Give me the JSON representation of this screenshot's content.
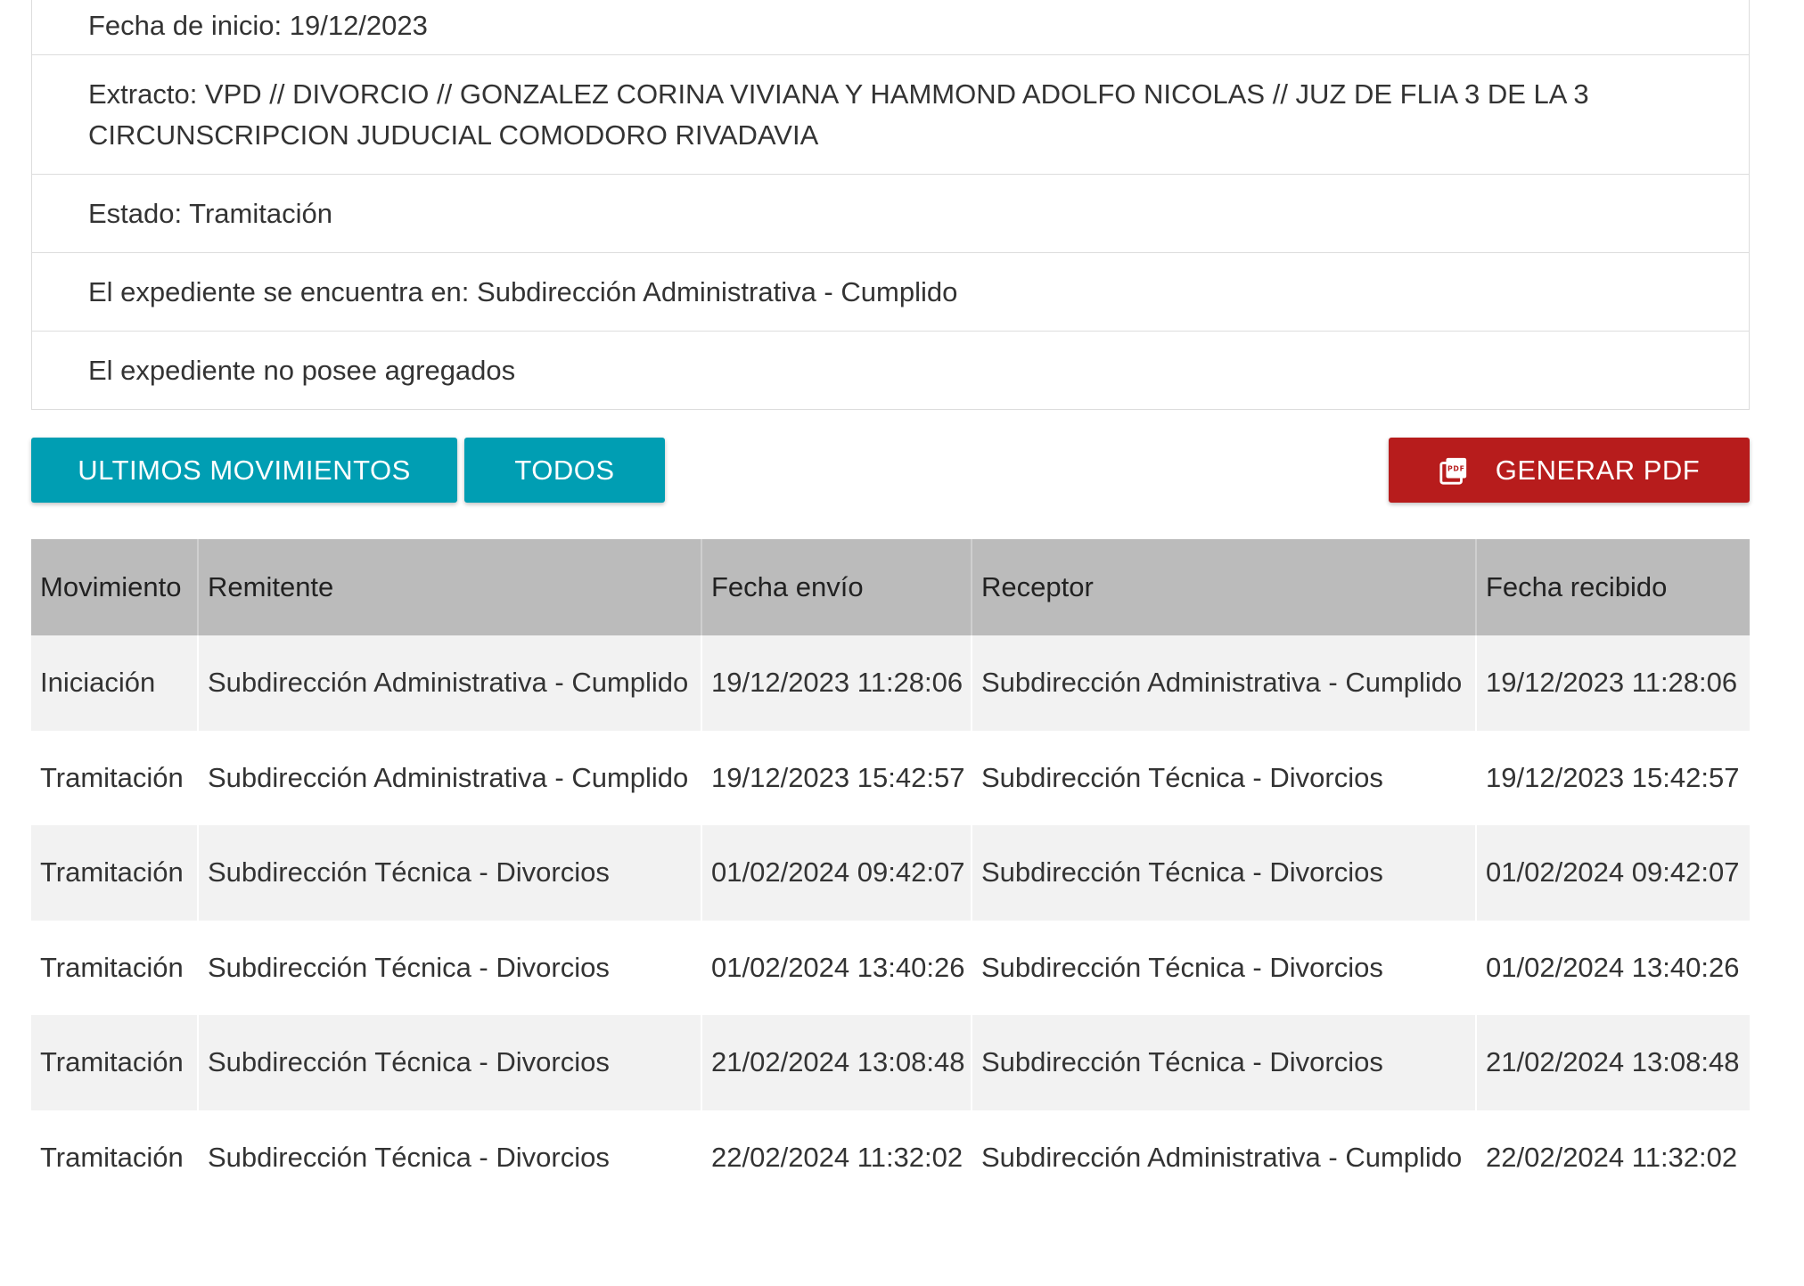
{
  "info": {
    "fecha_inicio": "Fecha de inicio: 19/12/2023",
    "extracto": "Extracto: VPD // DIVORCIO // GONZALEZ CORINA VIVIANA Y HAMMOND ADOLFO NICOLAS // JUZ DE FLIA 3 DE LA 3 CIRCUNSCRIPCION JUDUCIAL COMODORO RIVADAVIA",
    "estado": "Estado: Tramitación",
    "ubicacion": "El expediente se encuentra en: Subdirección Administrativa - Cumplido",
    "agregados": "El expediente no posee agregados"
  },
  "toolbar": {
    "ultimos_label": "ULTIMOS MOVIMIENTOS",
    "todos_label": "TODOS",
    "pdf_label": "GENERAR PDF",
    "pdf_icon": "pdf-icon"
  },
  "table": {
    "headers": [
      "Movimiento",
      "Remitente",
      "Fecha envío",
      "Receptor",
      "Fecha recibido"
    ],
    "rows": [
      [
        "Iniciación",
        "Subdirección Administrativa - Cumplido",
        "19/12/2023 11:28:06",
        "Subdirección Administrativa - Cumplido",
        "19/12/2023 11:28:06"
      ],
      [
        "Tramitación",
        "Subdirección Administrativa - Cumplido",
        "19/12/2023 15:42:57",
        "Subdirección Técnica - Divorcios",
        "19/12/2023 15:42:57"
      ],
      [
        "Tramitación",
        "Subdirección Técnica - Divorcios",
        "01/02/2024 09:42:07",
        "Subdirección Técnica - Divorcios",
        "01/02/2024 09:42:07"
      ],
      [
        "Tramitación",
        "Subdirección Técnica - Divorcios",
        "01/02/2024 13:40:26",
        "Subdirección Técnica - Divorcios",
        "01/02/2024 13:40:26"
      ],
      [
        "Tramitación",
        "Subdirección Técnica - Divorcios",
        "21/02/2024 13:08:48",
        "Subdirección Técnica - Divorcios",
        "21/02/2024 13:08:48"
      ],
      [
        "Tramitación",
        "Subdirección Técnica - Divorcios",
        "22/02/2024 11:32:02",
        "Subdirección Administrativa - Cumplido",
        "22/02/2024 11:32:02"
      ]
    ]
  },
  "colors": {
    "primary": "#009eb3",
    "danger": "#b71c1c",
    "header_bg": "#bbbbbb",
    "row_alt": "#f2f2f2"
  }
}
